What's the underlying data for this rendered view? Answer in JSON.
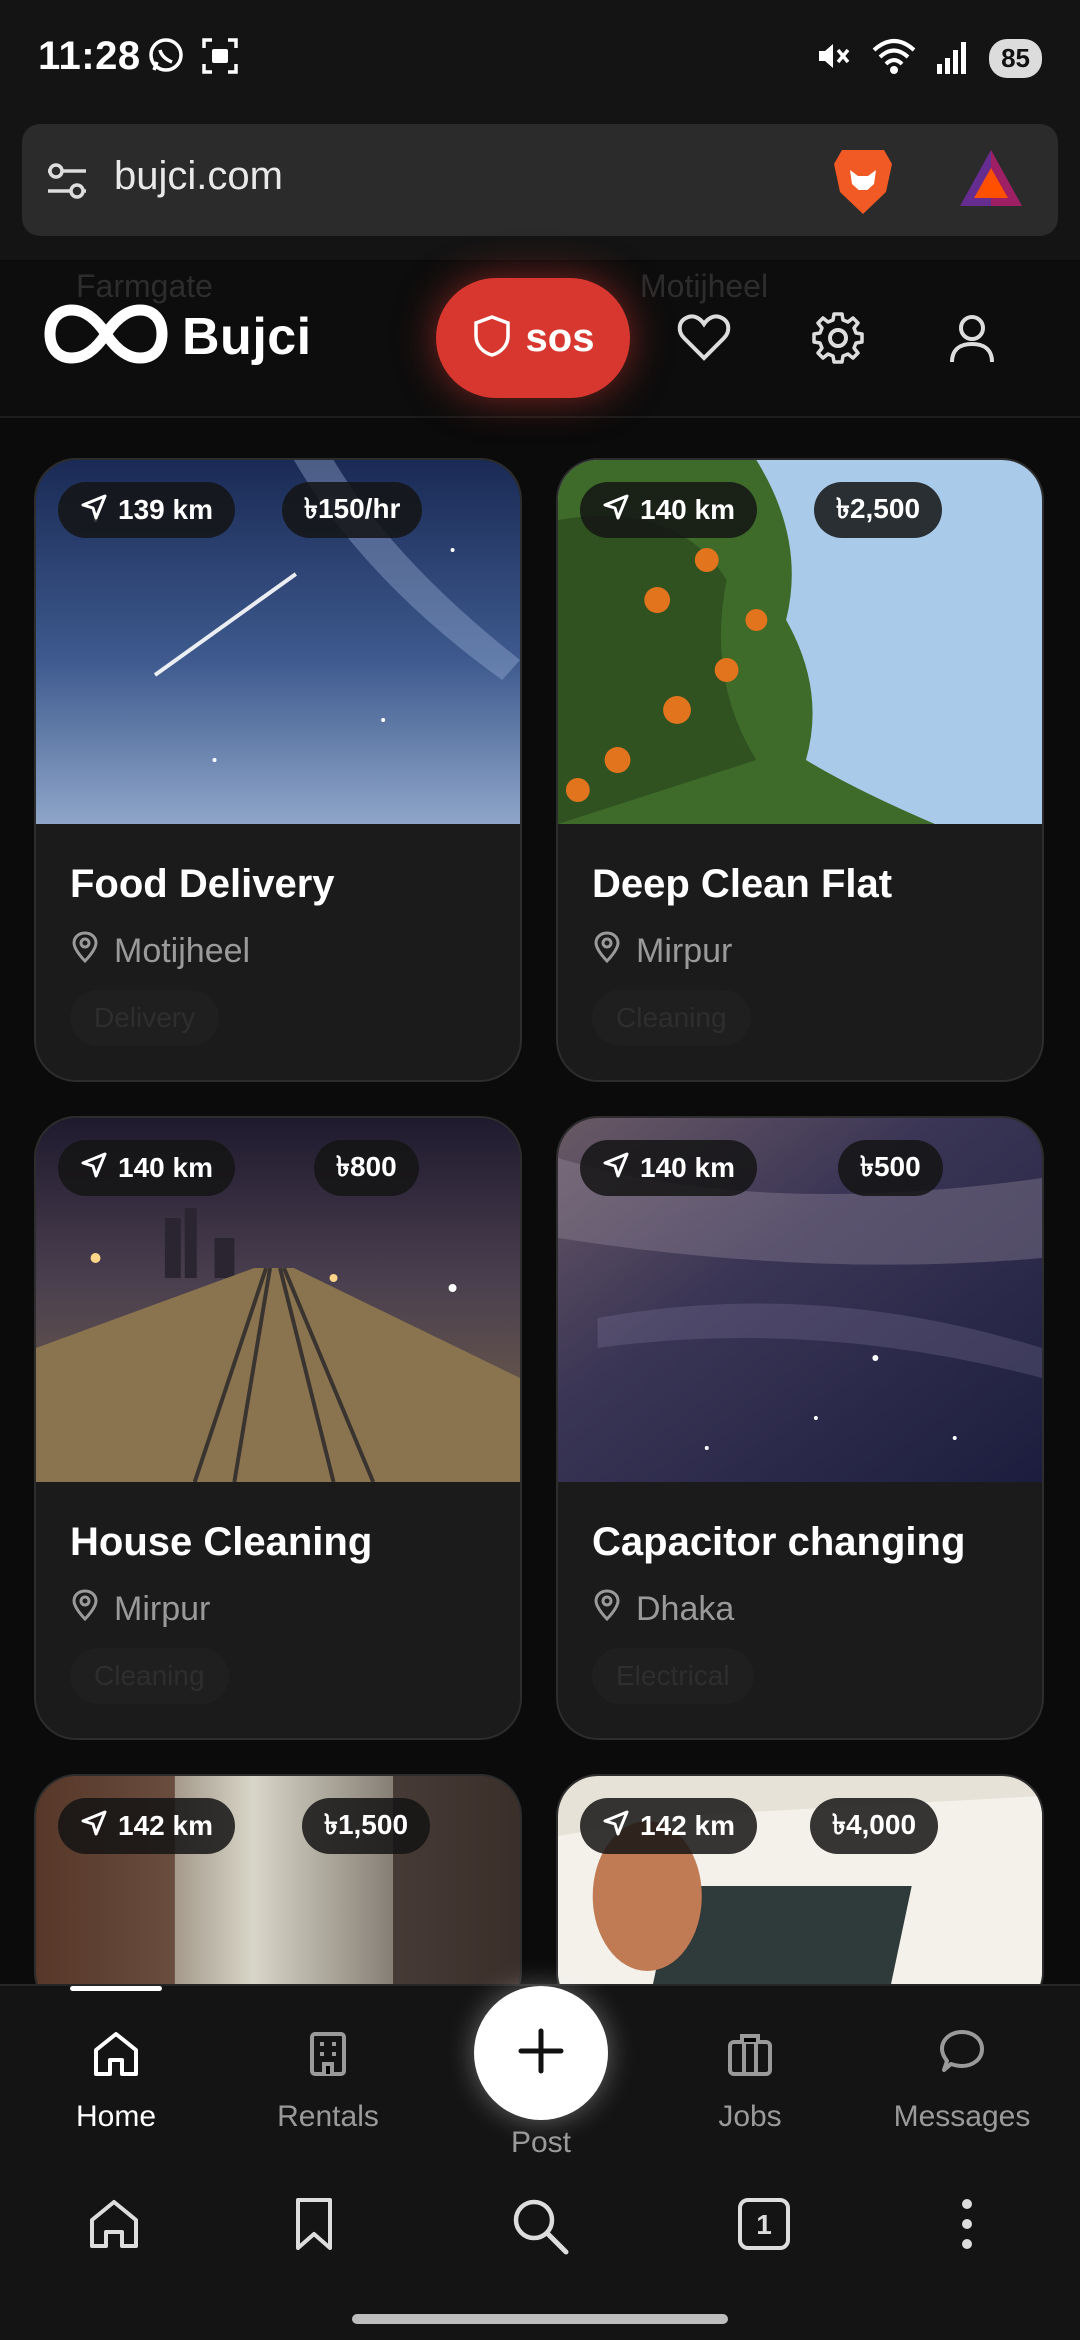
{
  "status_bar": {
    "time": "11:28",
    "battery": "85",
    "icons": [
      "whatsapp-icon",
      "screenshot-icon",
      "mute-icon",
      "wifi-icon",
      "signal-icon"
    ]
  },
  "browser": {
    "url": "bujci.com",
    "icons": [
      "site-settings-icon",
      "brave-lion-icon",
      "brave-rewards-icon"
    ],
    "toolbar": {
      "icons": [
        "home-icon",
        "bookmark-icon",
        "search-icon",
        "tabs-icon",
        "more-menu-icon"
      ],
      "tab_count": "1"
    }
  },
  "header": {
    "brand": "Bujci",
    "sos_label": "sos",
    "ghost_locations": [
      "Farmgate",
      "Motijheel"
    ],
    "icons": [
      "infinity-logo-icon",
      "shield-icon",
      "favorites-heart-icon",
      "settings-gear-icon",
      "profile-icon"
    ]
  },
  "listings": [
    {
      "title": "Food Delivery",
      "location": "Motijheel",
      "tag": "Delivery",
      "distance": "139 km",
      "price": "৳150/hr"
    },
    {
      "title": "Deep Clean Flat",
      "location": "Mirpur",
      "tag": "Cleaning",
      "distance": "140 km",
      "price": "৳2,500"
    },
    {
      "title": "House Cleaning",
      "location": "Mirpur",
      "tag": "Cleaning",
      "distance": "140 km",
      "price": "৳800"
    },
    {
      "title": "Capacitor changing",
      "location": "Dhaka",
      "tag": "Electrical",
      "distance": "140 km",
      "price": "৳500"
    },
    {
      "title": "",
      "location": "",
      "tag": "",
      "distance": "142 km",
      "price": "৳1,500"
    },
    {
      "title": "",
      "location": "",
      "tag": "",
      "distance": "142 km",
      "price": "৳4,000"
    }
  ],
  "bottom_nav": {
    "items": [
      {
        "label": "Home",
        "active": true
      },
      {
        "label": "Rentals",
        "active": false
      },
      {
        "label": "Post",
        "active": false
      },
      {
        "label": "Jobs",
        "active": false
      },
      {
        "label": "Messages",
        "active": false
      }
    ]
  },
  "colors": {
    "background": "#0b0b0b",
    "card": "#1b1b1b",
    "sos": "#d7372e",
    "brave_orange": "#f15a24"
  }
}
